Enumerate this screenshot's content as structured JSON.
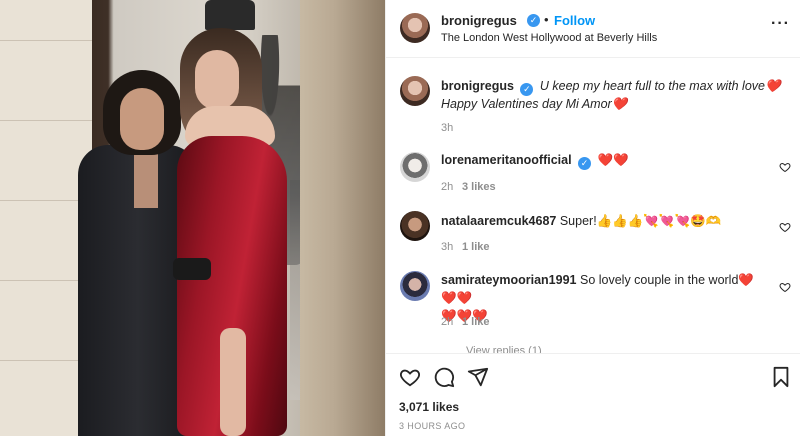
{
  "post": {
    "author": "bronigregus",
    "follow_label": "Follow",
    "separator": "•",
    "location": "The London West Hollywood at Beverly Hills",
    "more_icon": "more-options-icon",
    "verified_icon": "verified-badge-icon"
  },
  "caption": {
    "username": "bronigregus",
    "line1": "U keep my heart full to the max with love❤️",
    "line2": "Happy Valentines day Mi Amor❤️",
    "time": "3h"
  },
  "comments": [
    {
      "username": "lorenameritanoofficial",
      "text": "❤️❤️",
      "time": "2h",
      "likes": "3 likes",
      "verified": true
    },
    {
      "username": "natalaaremcuk4687",
      "text": "Super!👍👍👍💘💘💘🤩🫶",
      "time": "3h",
      "likes": "1 like",
      "verified": false
    },
    {
      "username": "samirateymoorian1991",
      "text": "So lovely couple in the world❤️❤️❤️",
      "text_line2": "❤️❤️❤️",
      "time": "2h",
      "likes": "1 like",
      "verified": false
    }
  ],
  "view_replies": "View replies (1)",
  "actions": {
    "like_icon": "heart-icon",
    "comment_icon": "comment-icon",
    "share_icon": "share-icon",
    "save_icon": "bookmark-icon",
    "likes_count": "3,071 likes",
    "timestamp": "3 HOURS AGO"
  },
  "colors": {
    "link_blue": "#0095f6",
    "verified_blue": "#3897f0",
    "text": "#262626",
    "muted": "#8e8e8e",
    "dress_red": "#9b1626"
  }
}
